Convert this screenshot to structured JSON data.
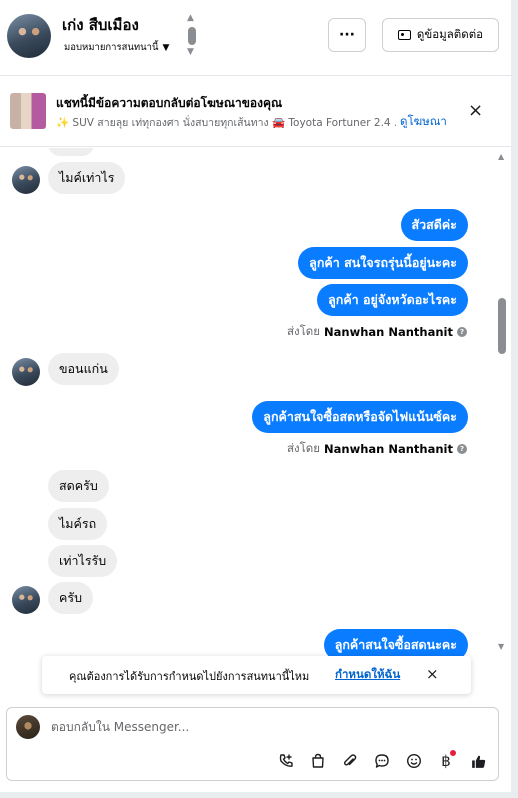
{
  "header": {
    "contact_name": "เก่ง สืบเมือง",
    "assign_label": "มอบหมายการสนทนานี้",
    "more_label": "···",
    "contact_info_label": "ดูข้อมูลติดต่อ"
  },
  "ad_banner": {
    "title": "แชทนี้มีข้อความตอบกลับต่อโฆษณาของคุณ",
    "subtitle_part1": "SUV สายลุย เท่ทุกองศา นั่งสบายทุกเส้นทาง",
    "subtitle_part2": "Toyota Fortuner 2.4 ...",
    "view_ad_link": "ดูโฆษณา",
    "close_icon": "×"
  },
  "messages": [
    {
      "direction": "in",
      "text": "ไมค์เท่าไร"
    },
    {
      "direction": "out",
      "text": "สัวสดีค่ะ"
    },
    {
      "direction": "out",
      "text": "ลูกค้า สนใจรถรุ่นนี้อยู่นะคะ"
    },
    {
      "direction": "out",
      "text": "ลูกค้า อยู่จังหวัดอะไรคะ"
    },
    {
      "direction": "in",
      "text": "ขอนแก่น"
    },
    {
      "direction": "out",
      "text": "ลูกค้าสนใจซื้อสดหรือจัดไฟแน้นซ์คะ"
    },
    {
      "direction": "in",
      "text": "สดครับ"
    },
    {
      "direction": "in",
      "text": "ไมค์รถ"
    },
    {
      "direction": "in",
      "text": "เท่าไรรับ"
    },
    {
      "direction": "in",
      "text": "ครับ"
    },
    {
      "direction": "out",
      "text": "ลูกค้าสนใจซื้อสดนะคะ"
    }
  ],
  "sent_by": {
    "prefix": "ส่งโดย",
    "name": "Nanwhan Nanthanit"
  },
  "toast": {
    "text": "คุณต้องการได้รับการกำหนดไปยังการสนทนานี้ไหม",
    "link": "กำหนดให้ฉัน",
    "close_icon": "×"
  },
  "composer": {
    "placeholder": "ตอบกลับใน Messenger...",
    "tools": [
      "phone-plus-icon",
      "shopping-bag-icon",
      "paperclip-icon",
      "chat-bubble-icon",
      "emoji-icon",
      "baht-icon",
      "thumbs-up-icon"
    ]
  },
  "colors": {
    "outgoing_bubble": "#0a7cff",
    "incoming_bubble": "#eeeeef",
    "link": "#0064d1"
  }
}
